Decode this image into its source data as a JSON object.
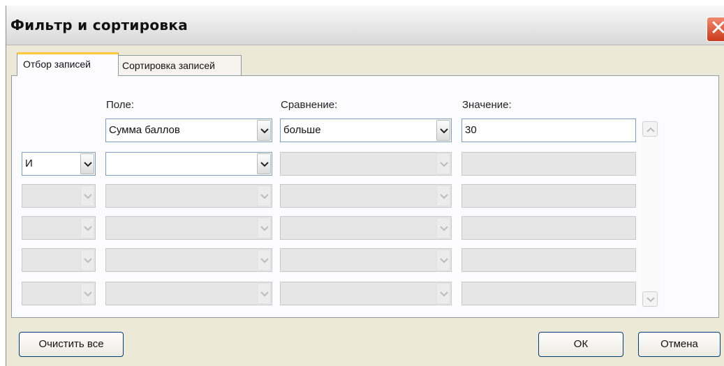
{
  "dialog": {
    "title": "Фильтр и сортировка",
    "close_glyph": "✕"
  },
  "tabs": [
    {
      "label": "Отбор записей",
      "active": true
    },
    {
      "label": "Сортировка записей",
      "active": false
    }
  ],
  "columns": {
    "field": "Поле:",
    "comparison": "Сравнение:",
    "value": "Значение:"
  },
  "rows": [
    {
      "connector": null,
      "field": "Сумма баллов",
      "comparison": "больше",
      "value": "30",
      "enabled": true
    },
    {
      "connector": "И",
      "field": "",
      "comparison": "",
      "value": "",
      "enabled": true
    },
    {
      "connector": "",
      "field": "",
      "comparison": "",
      "value": "",
      "enabled": false
    },
    {
      "connector": "",
      "field": "",
      "comparison": "",
      "value": "",
      "enabled": false
    },
    {
      "connector": "",
      "field": "",
      "comparison": "",
      "value": "",
      "enabled": false
    },
    {
      "connector": "",
      "field": "",
      "comparison": "",
      "value": "",
      "enabled": false
    }
  ],
  "buttons": {
    "clear_all": "Очистить все",
    "ok": "ОК",
    "cancel": "Отмена"
  },
  "colors": {
    "accent_tab": "#ffc83c",
    "close": "#c93a1e",
    "field_border": "#7f9db9"
  }
}
